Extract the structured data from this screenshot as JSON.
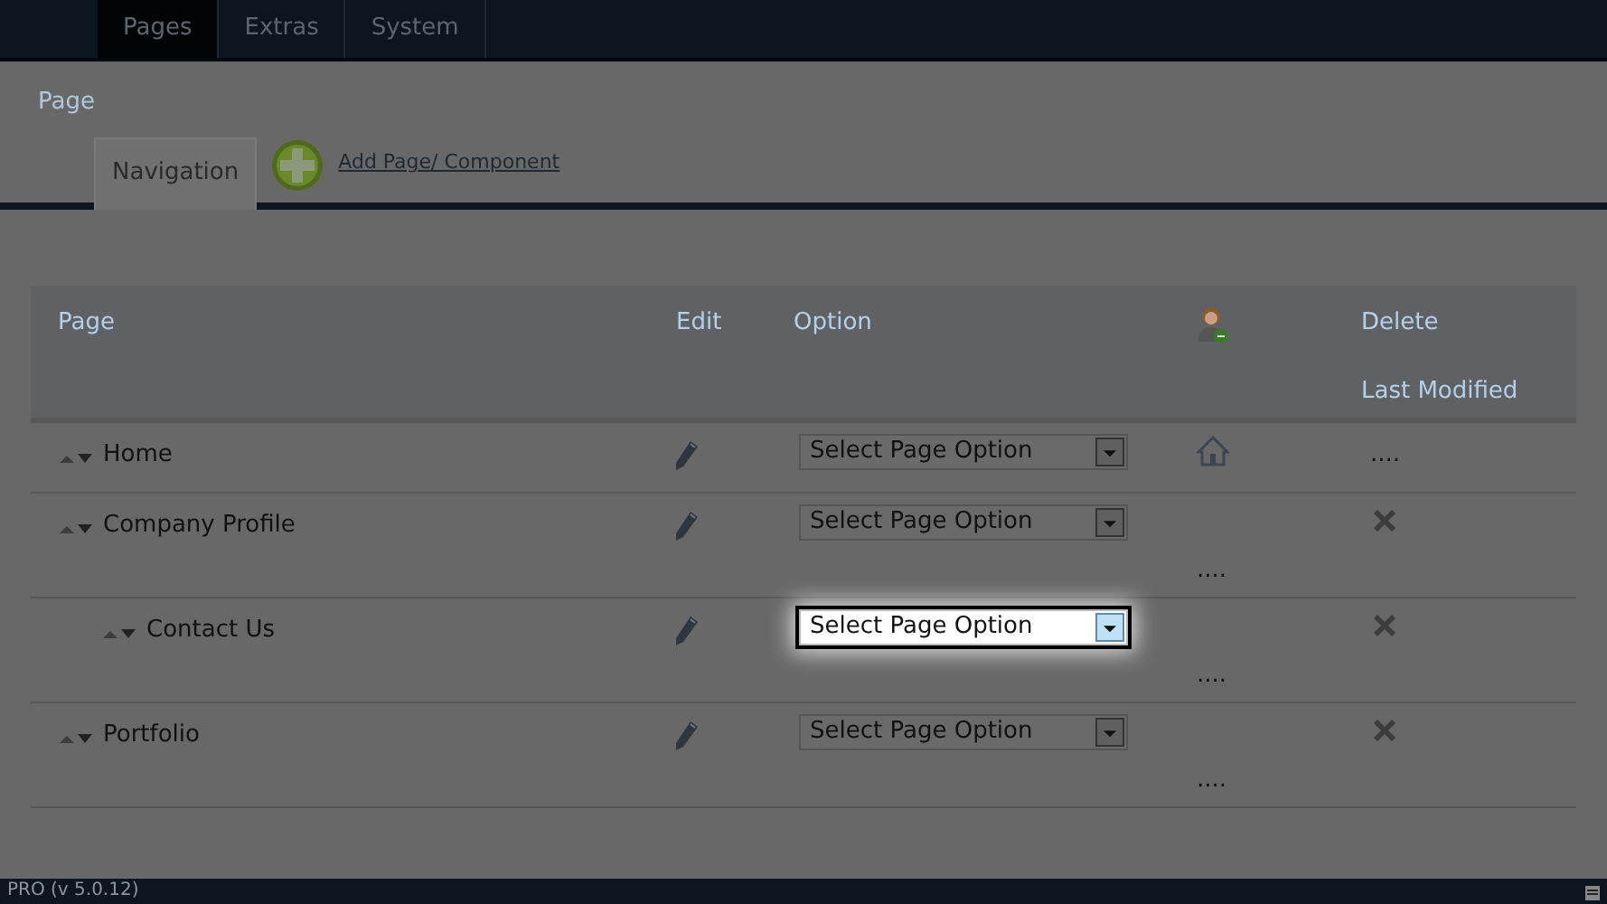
{
  "top_tabs": [
    {
      "label": "Pages",
      "selected": true
    },
    {
      "label": "Extras",
      "selected": false
    },
    {
      "label": "System",
      "selected": false
    }
  ],
  "page_title": "Page",
  "sub_tabs": [
    {
      "label": "Navigation",
      "selected": true
    }
  ],
  "add_link": "Add Page/ Component",
  "table": {
    "columns": [
      "Page",
      "Edit",
      "Option",
      "Delete",
      "Last Modified"
    ],
    "rows": [
      {
        "name": "Home",
        "option": "Select Page Option",
        "highlighted": false,
        "home": true,
        "deletable": false,
        "modified": "...."
      },
      {
        "name": "Company Profile",
        "option": "Select Page Option",
        "highlighted": false,
        "home": false,
        "deletable": true,
        "modified": "....",
        "children": [
          {
            "name": "Contact Us",
            "option": "Select Page Option",
            "highlighted": true,
            "home": false,
            "deletable": true,
            "modified": "...."
          }
        ]
      },
      {
        "name": "Portfolio",
        "option": "Select Page Option",
        "highlighted": false,
        "home": false,
        "deletable": true,
        "modified": "...."
      }
    ]
  },
  "status_bar": "PRO (v 5.0.12)"
}
